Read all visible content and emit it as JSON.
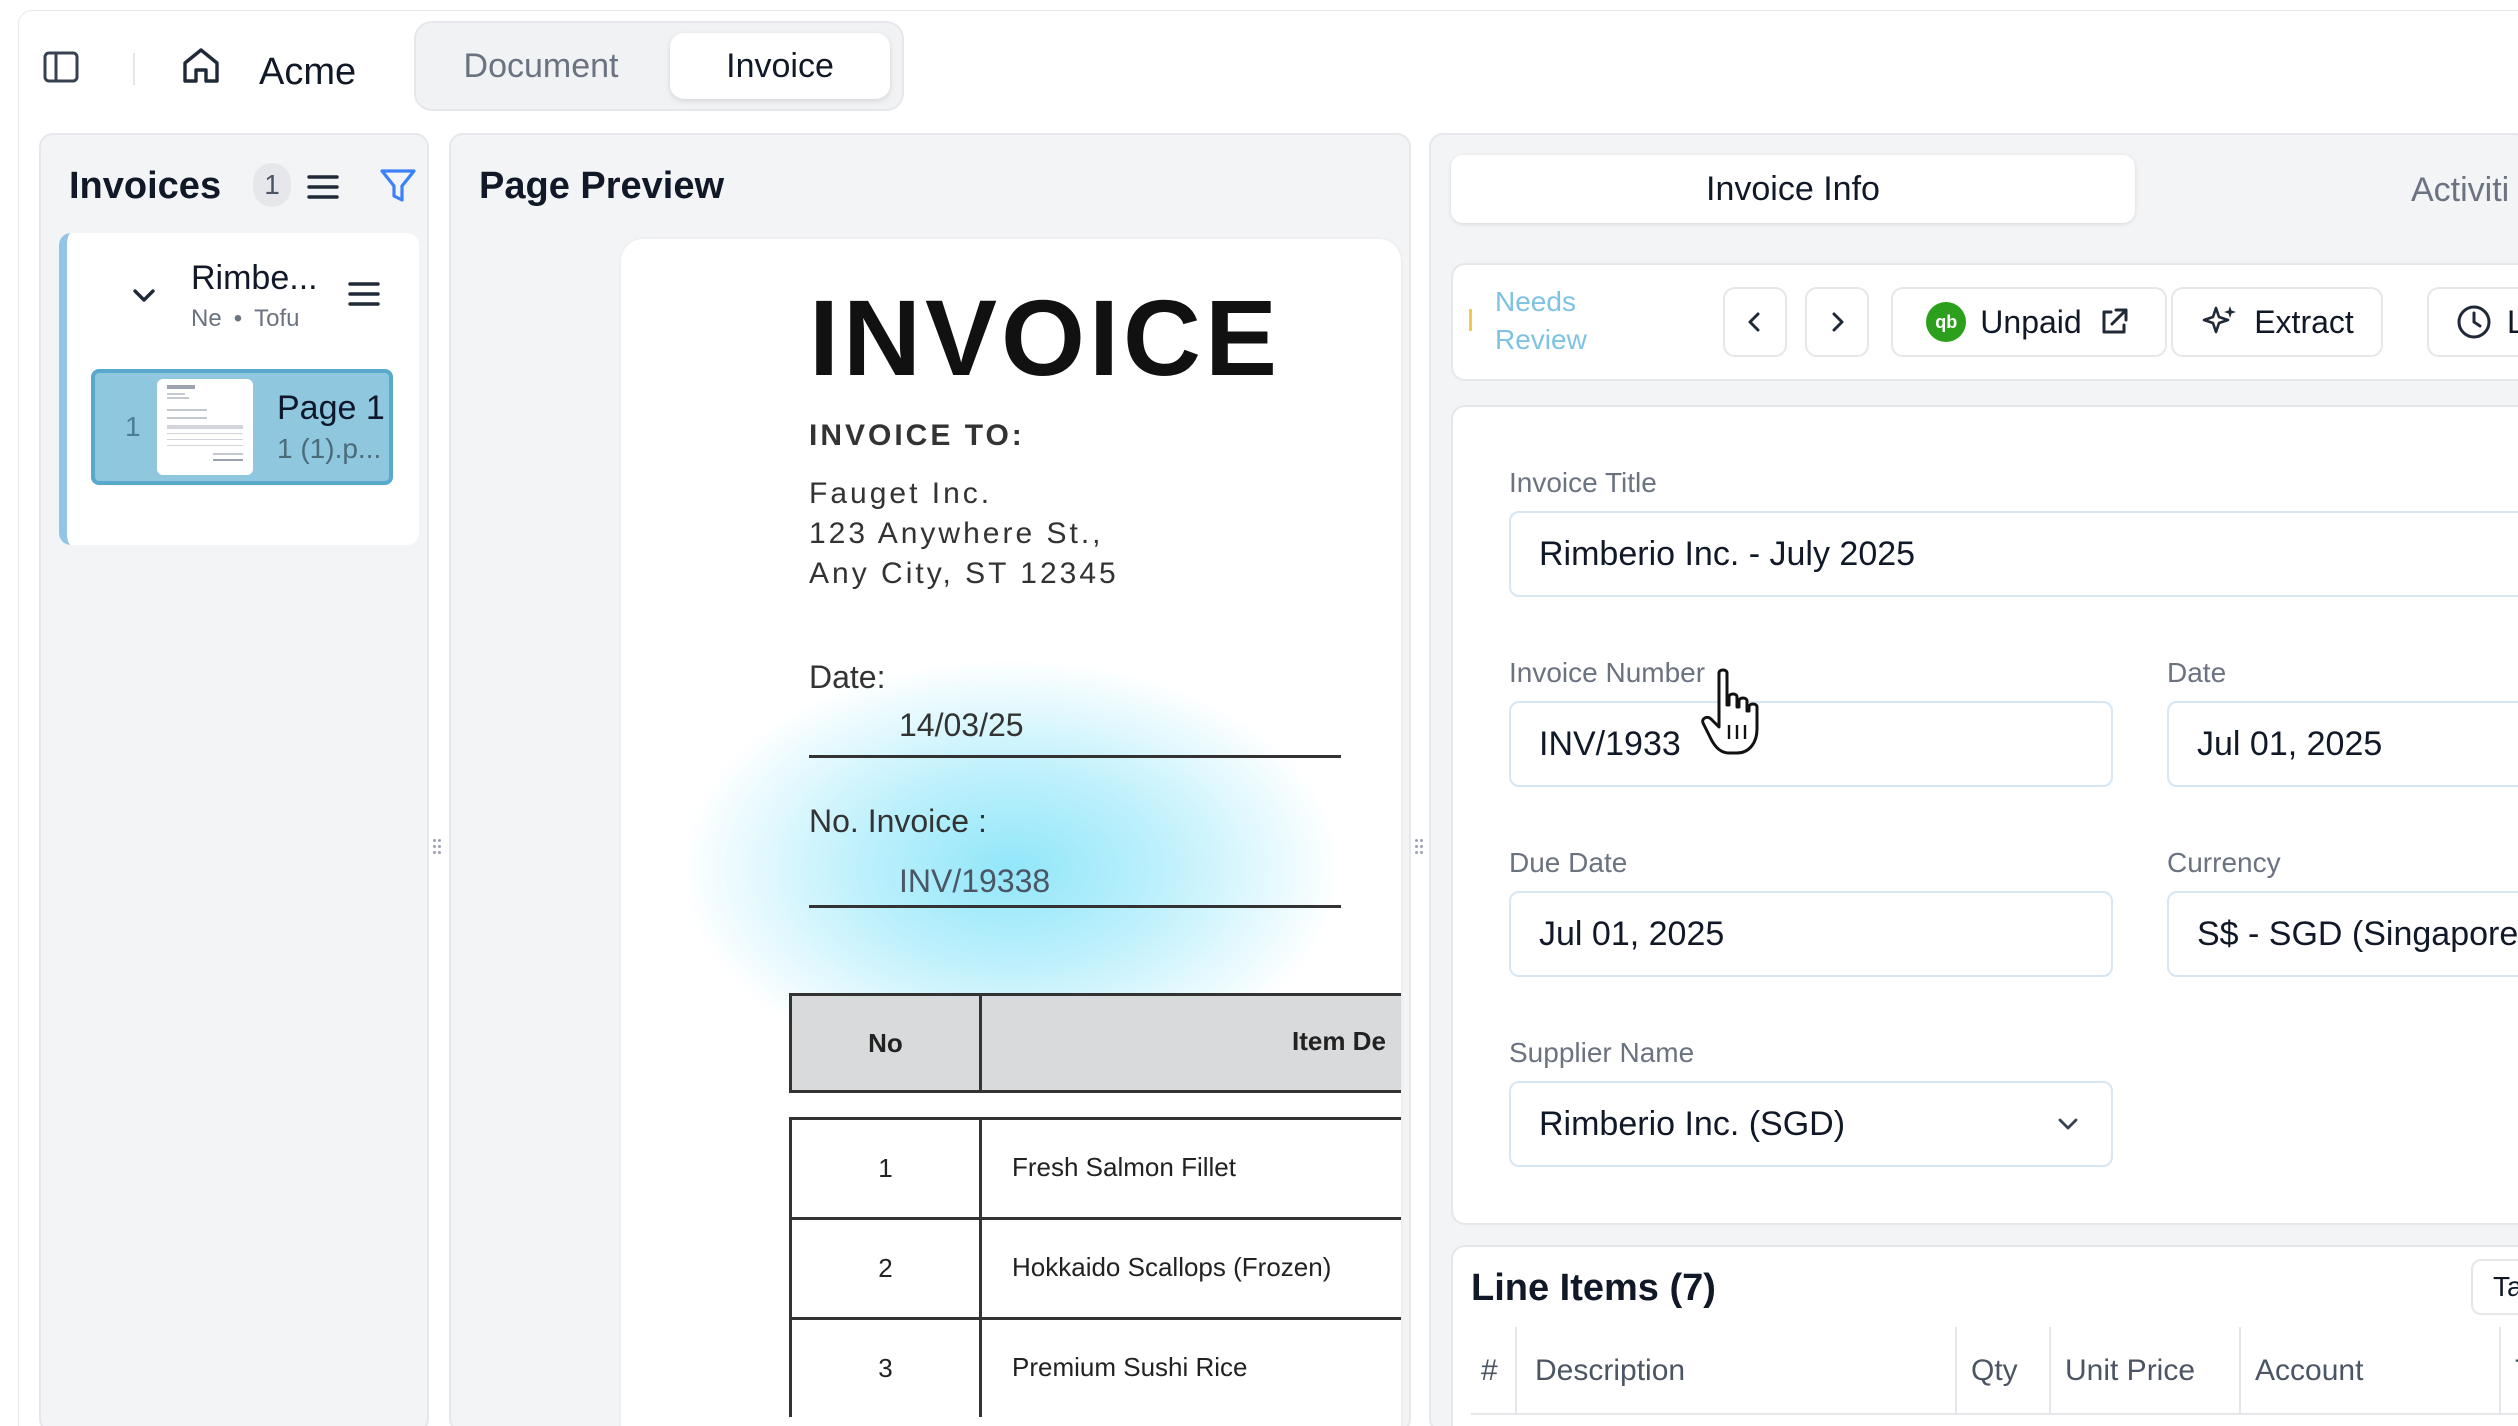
{
  "topbar": {
    "brand": "Acme",
    "tabs": [
      {
        "label": "Document",
        "active": false
      },
      {
        "label": "Invoice",
        "active": true
      }
    ]
  },
  "invoices_panel": {
    "title": "Invoices",
    "count": "1",
    "group": {
      "name": "Rimbe...",
      "meta_status": "Ne",
      "meta_sep": "•",
      "meta_owner": "Tofu",
      "page": {
        "index": "1",
        "title": "Page 1",
        "subtitle": "1 (1).p..."
      }
    }
  },
  "preview_panel": {
    "title": "Page Preview",
    "document": {
      "heading": "INVOICE",
      "to_label": "INVOICE TO:",
      "address": [
        "Fauget Inc.",
        "123 Anywhere St.,",
        "Any City, ST 12345"
      ],
      "date_label": "Date:",
      "date_value": "14/03/25",
      "no_label": "No. Invoice :",
      "no_value": "INV/19338",
      "table": {
        "headers": [
          "No",
          "Item De"
        ],
        "rows": [
          {
            "no": "1",
            "item": "Fresh Salmon Fillet"
          },
          {
            "no": "2",
            "item": "Hokkaido Scallops (Frozen)"
          },
          {
            "no": "3",
            "item": "Premium Sushi Rice"
          }
        ]
      }
    }
  },
  "details_panel": {
    "tabs": [
      {
        "label": "Invoice Info",
        "active": true
      },
      {
        "label": "Activiti",
        "active": false
      }
    ],
    "toolbar": {
      "status": "Needs Review",
      "status_line1": "Needs",
      "status_line2": "Review",
      "payment_status": "Unpaid",
      "qb_logo": "qb",
      "extract_label": "Extract",
      "last_label": "La"
    },
    "form": {
      "invoice_title_label": "Invoice Title",
      "invoice_title_value": "Rimberio Inc. - July 2025",
      "invoice_number_label": "Invoice Number",
      "invoice_number_value": "INV/1933",
      "date_label": "Date",
      "date_value": "Jul 01, 2025",
      "due_date_label": "Due Date",
      "due_date_value": "Jul 01, 2025",
      "currency_label": "Currency",
      "currency_value": "S$ - SGD (Singapore",
      "supplier_label": "Supplier Name",
      "supplier_value": "Rimberio Inc. (SGD)"
    },
    "line_items": {
      "title": "Line Items (7)",
      "tax_button": "Tax",
      "columns": [
        "#",
        "Description",
        "Qty",
        "Unit Price",
        "Account",
        "T"
      ]
    }
  },
  "colors": {
    "accent_blue": "#3b82f6",
    "needs_review": "#7ec2e4",
    "quickbooks_green": "#2ca01c",
    "selected_page": "#8ec7de",
    "highlight_glow": "#6cdef8"
  }
}
